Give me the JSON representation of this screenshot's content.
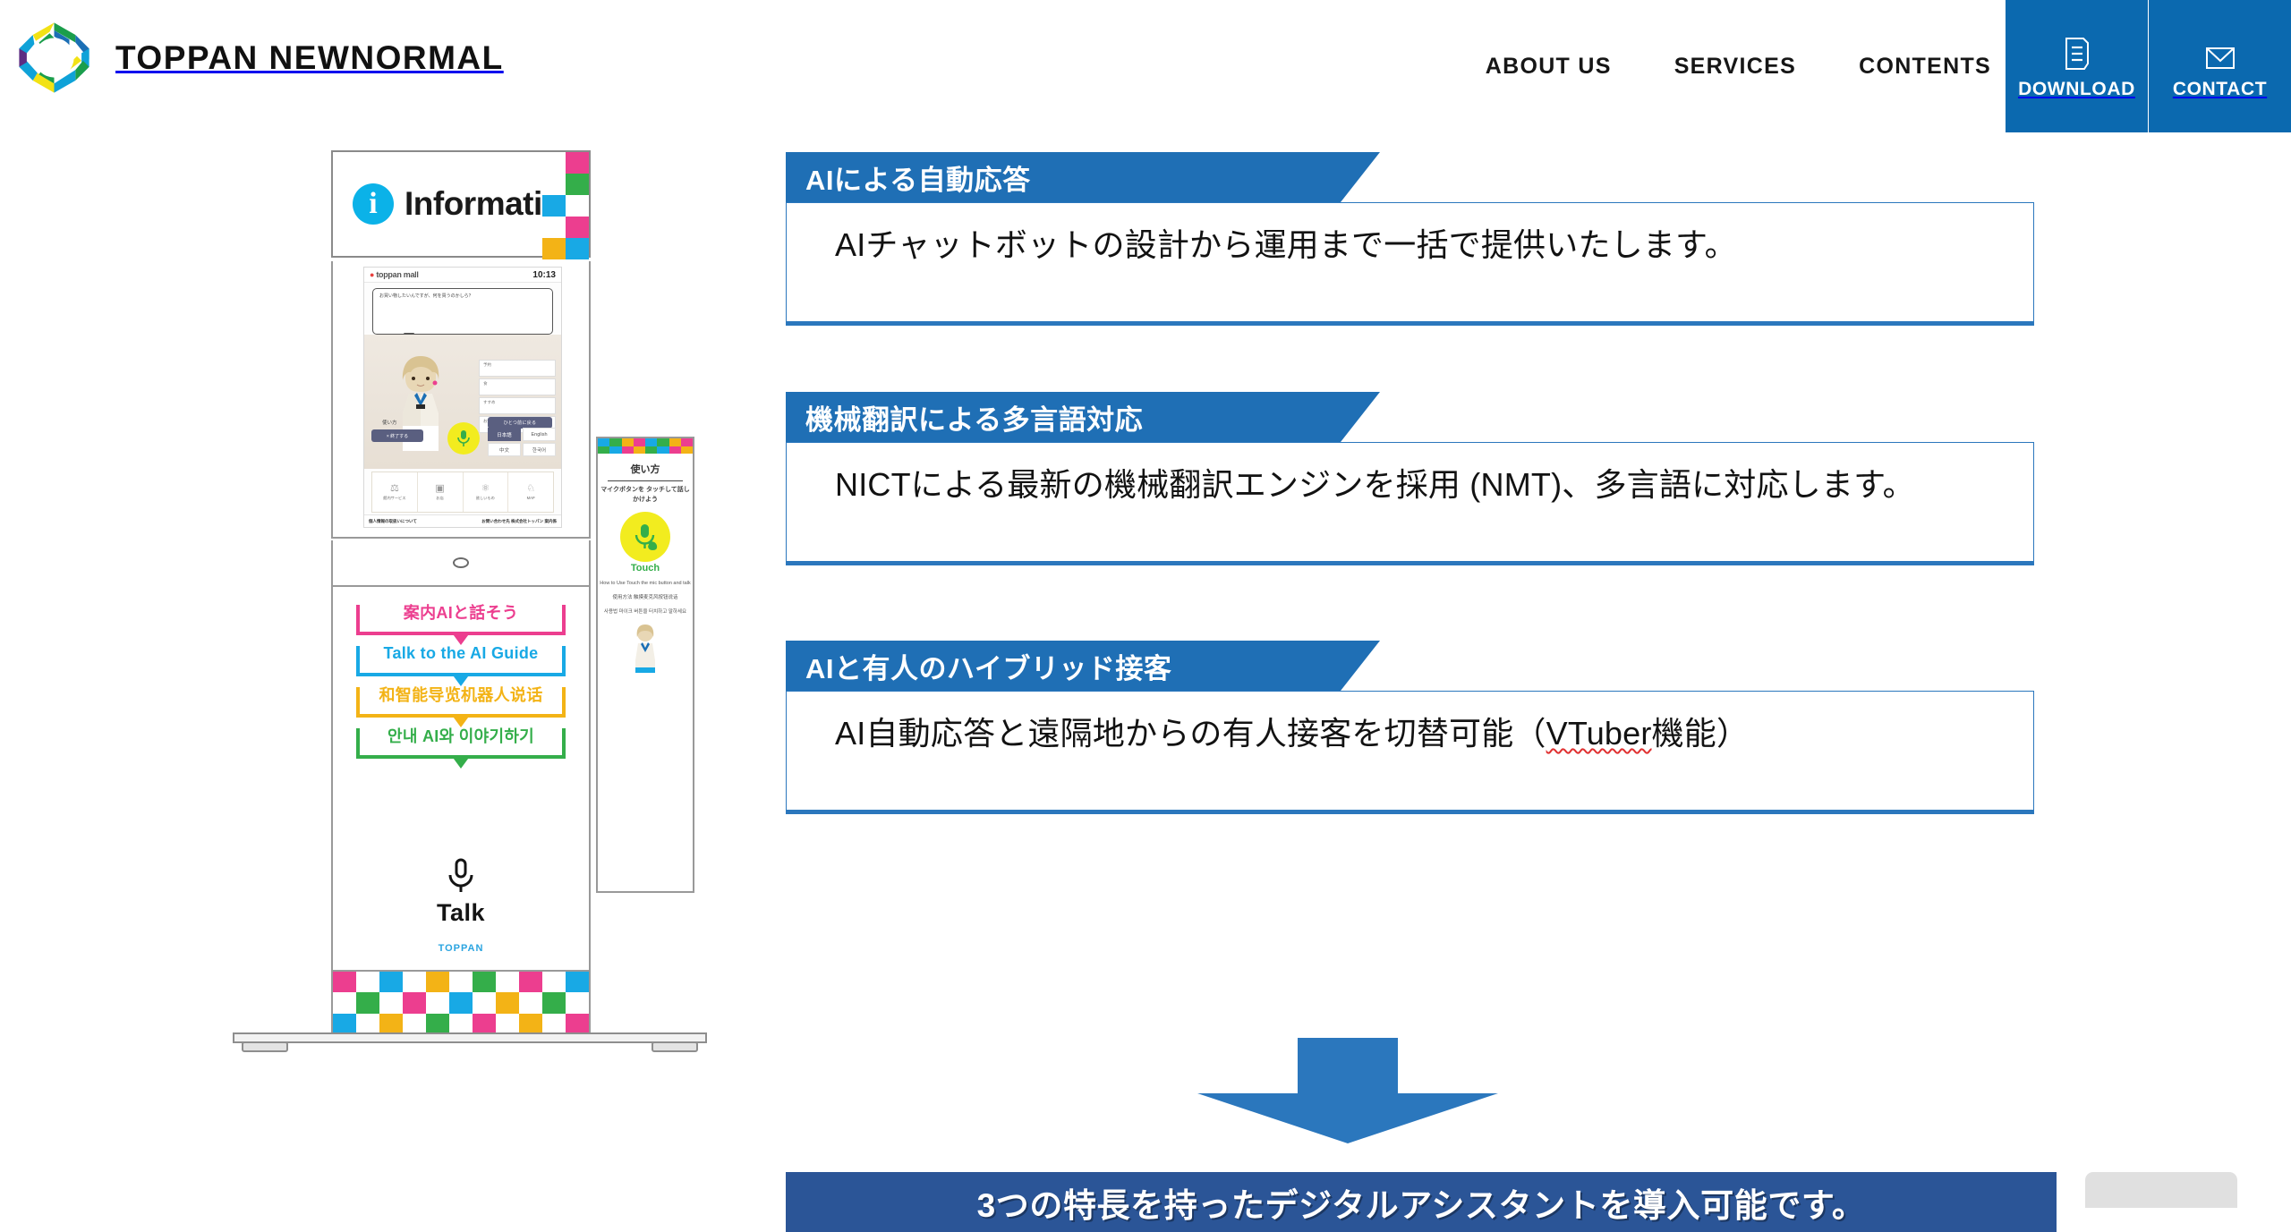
{
  "header": {
    "brand_name": "TOPPAN NEWNORMAL",
    "brand_logo_icon": "toppan-octagon-logo",
    "nav": [
      {
        "label": "ABOUT US"
      },
      {
        "label": "SERVICES"
      },
      {
        "label": "CONTENTS"
      }
    ],
    "actions": [
      {
        "label": "DOWNLOAD",
        "icon": "document-download-icon",
        "color": "#0b69af"
      },
      {
        "label": "CONTACT",
        "icon": "envelope-mail-icon",
        "color": "#0b69af"
      }
    ]
  },
  "kiosk": {
    "top_sign": {
      "icon": "information-circle-icon",
      "label": "Information"
    },
    "tablet": {
      "app_name": "toppan mall",
      "time": "10:13",
      "speech_bubble": "お買い物したいんですが、何を買うのかしら？",
      "menu_items": [
        "予約",
        "食",
        "すすめ",
        "お知らせ"
      ],
      "back_button": "ひとつ前に戻る",
      "mic_icon": "microphone-icon",
      "languages": [
        "日本語",
        "English",
        "中文",
        "한국어"
      ],
      "selected_language": "日本語",
      "howto_label": "使い方",
      "howto_button": "× 終了する",
      "shortcuts": [
        {
          "icon": "services-icon",
          "label": "館内サービス"
        },
        {
          "icon": "floor-icon",
          "label": "お店"
        },
        {
          "icon": "news-icon",
          "label": "欲しいもの"
        },
        {
          "icon": "map-icon",
          "label": "MAP"
        }
      ],
      "footer_left": "個人情報の取扱いについて",
      "footer_right": "お問い合わせ先 株式会社トッパン 案内係"
    },
    "camera_icon": "camera-lens-icon",
    "ribbons": [
      {
        "text": "案内AIと話そう",
        "color": "#ec3e8f",
        "lang": "ja"
      },
      {
        "text": "Talk to the AI Guide",
        "color": "#18a9e5",
        "lang": "en"
      },
      {
        "text": "和智能导览机器人说话",
        "color": "#f3b316",
        "lang": "zh"
      },
      {
        "text": "안내 AI와 이야기하기",
        "color": "#34ae4a",
        "lang": "ko"
      }
    ],
    "talk": {
      "icon": "microphone-icon",
      "label": "Talk"
    },
    "brand_footer": "TOPPAN",
    "side_panel": {
      "title": "使い方",
      "subtitle": "マイクボタンを\nタッチして話しかけよう",
      "touch_icon": "microphone-touch-icon",
      "touch_label": "Touch",
      "lines": [
        "How to Use\nTouch the mic button and talk",
        "使用方法\n触摸麦克风按钮说话",
        "사용법\n마이크 버튼을 터치하고 말하세요"
      ]
    },
    "base_palette": [
      "#ec3e8f",
      "#18a9e5",
      "#f3b316",
      "#34ae4a",
      "#ffffff"
    ]
  },
  "features": [
    {
      "title": "AIによる自動応答",
      "body": "AIチャットボットの設計から運用まで一括で提供いたします。",
      "header_color": "#1f6fb5",
      "border_color": "#2b77bd"
    },
    {
      "title": "機械翻訳による多言語対応",
      "body": "NICTによる最新の機械翻訳エンジンを採用 (NMT)、多言語に対応します。",
      "header_color": "#1f6fb5",
      "border_color": "#2b77bd"
    },
    {
      "title": "AIと有人のハイブリッド接客",
      "body_pre": "AI自動応答と遠隔地からの有人接客を切替可能（",
      "body_spellcheck": "VTuber",
      "body_post": "機能）",
      "header_color": "#1f6fb5",
      "border_color": "#2b77bd"
    }
  ],
  "arrow": {
    "icon": "down-arrow-icon",
    "color": "#2b77bd"
  },
  "conclusion": {
    "text": "3つの特長を持ったデジタルアシスタントを導入可能です。",
    "background": "#2b5597",
    "text_color": "#ffffff"
  }
}
